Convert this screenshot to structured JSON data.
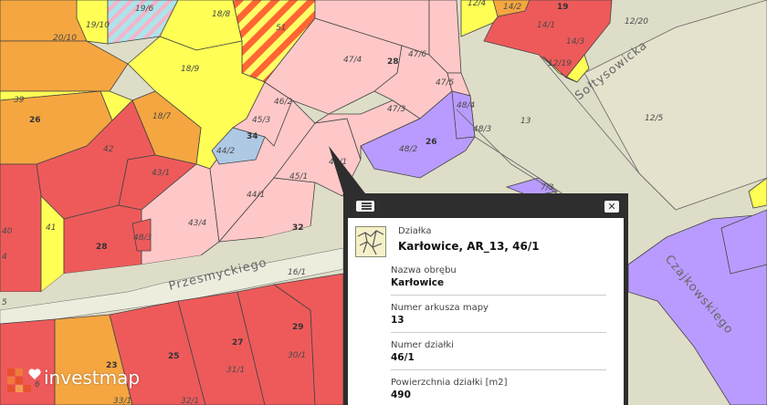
{
  "colors": {
    "road": "#deddc8",
    "residential": "#ffc8c8",
    "service": "#ee5a5a",
    "commercial": "#f5a640",
    "green": "#ffff55",
    "mixed": "#b99bff",
    "hatched": "#ff7733",
    "blueish": "#aec9e4",
    "popup_bg": "#2e2e2e",
    "brand_orange": "#e8512e"
  },
  "streets": {
    "przesmyckiego": "Przesmyckiego",
    "soltysowicka": "Sołtysowicka",
    "czajkowskiego": "Czajkowskiego"
  },
  "parcel_labels": {
    "l_20_10": "20/10",
    "l_19_10": "19/10",
    "l_19_6": "19/6",
    "l_18_8": "18/8",
    "l_51": "51",
    "l_12_4": "12/4",
    "l_14_2": "14/2",
    "l_19": "19",
    "l_14_1": "14/1",
    "l_12_20": "12/20",
    "l_39": "39",
    "l_26a": "26",
    "l_18_9": "18/9",
    "l_47_4": "47/4",
    "l_28a": "28",
    "l_47_6": "47/6",
    "l_14_3": "14/3",
    "l_12_19": "12/19",
    "l_47_5": "47/5",
    "l_12_5": "12/5",
    "l_13": "13",
    "l_46_2": "46/2",
    "l_47_3": "47/3",
    "l_48_4": "48/4",
    "l_18_7": "18/7",
    "l_45_3": "45/3",
    "l_34": "34",
    "l_48_3": "48/3",
    "l_42": "42",
    "l_48_2": "48/2",
    "l_26b": "26",
    "l_44_2": "44/2",
    "l_46_1": "46/1",
    "l_43_1": "43/1",
    "l_45_1": "45/1",
    "l_7_3": "7/3",
    "l_40": "40",
    "l_44_1": "44/1",
    "l_41": "41",
    "l_43_4": "43/4",
    "l_32": "32",
    "l_48_3b": "48/3",
    "l_28b": "28",
    "l_4": "4",
    "l_16_1": "16/1",
    "l_29": "29",
    "l_27": "27",
    "l_30_1": "30/1",
    "l_25": "25",
    "l_31_1": "31/1",
    "l_23": "23",
    "l_32_1": "32/1",
    "l_33_1": "33/1",
    "l_5": "5",
    "l_6": "6"
  },
  "popup": {
    "menu_icon": "list-icon",
    "close_label": "✕",
    "layer_type": "Działka",
    "title": "Karłowice, AR_13, 46/1",
    "fields": [
      {
        "key": "Nazwa obrębu",
        "value": "Karłowice"
      },
      {
        "key": "Numer arkusza mapy",
        "value": "13"
      },
      {
        "key": "Numer działki",
        "value": "46/1"
      },
      {
        "key": "Powierzchnia działki [m2]",
        "value": "490"
      }
    ]
  },
  "brand": {
    "name": "investmap"
  }
}
